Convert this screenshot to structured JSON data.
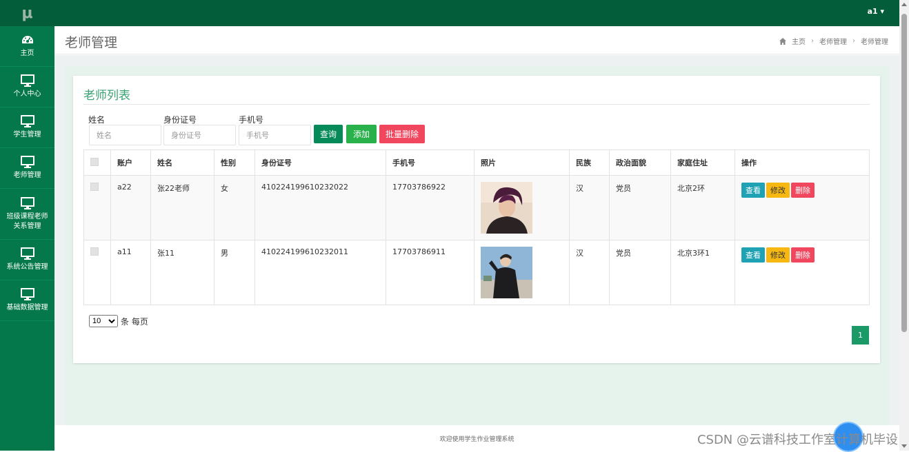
{
  "app": {
    "logo": "μ",
    "user": "a1 ▾"
  },
  "sidebar": {
    "items": [
      {
        "label": "主页",
        "icon": "dashboard-icon"
      },
      {
        "label": "个人中心",
        "icon": "monitor-icon"
      },
      {
        "label": "学生管理",
        "icon": "monitor-icon"
      },
      {
        "label": "老师管理",
        "icon": "monitor-icon"
      },
      {
        "label": "班级课程老师关系管理",
        "icon": "monitor-icon"
      },
      {
        "label": "系统公告管理",
        "icon": "monitor-icon"
      },
      {
        "label": "基础数据管理",
        "icon": "monitor-icon"
      }
    ]
  },
  "header": {
    "title": "老师管理",
    "breadcrumb": [
      "主页",
      "老师管理",
      "老师管理"
    ]
  },
  "card": {
    "title": "老师列表"
  },
  "filters": {
    "name_label": "姓名",
    "name_placeholder": "姓名",
    "id_label": "身份证号",
    "id_placeholder": "身份证号",
    "phone_label": "手机号",
    "phone_placeholder": "手机号"
  },
  "buttons": {
    "search": "查询",
    "add": "添加",
    "batch_delete": "批量删除"
  },
  "table": {
    "headers": [
      "账户",
      "姓名",
      "性别",
      "身份证号",
      "手机号",
      "照片",
      "民族",
      "政治面貌",
      "家庭住址",
      "操作"
    ],
    "rows": [
      {
        "account": "a22",
        "name": "张22老师",
        "gender": "女",
        "id": "410224199610232022",
        "phone": "17703786922",
        "ethnic": "汉",
        "political": "党员",
        "address": "北京2环"
      },
      {
        "account": "a11",
        "name": "张11",
        "gender": "男",
        "id": "410224199610232011",
        "phone": "17703786911",
        "ethnic": "汉",
        "political": "党员",
        "address": "北京3环1"
      }
    ],
    "ops": {
      "view": "查看",
      "edit": "修改",
      "delete": "删除"
    }
  },
  "pagination": {
    "page_size": "10",
    "page_size_suffix": "条 每页",
    "current_page": "1"
  },
  "footer": {
    "text": "欢迎使用学生作业管理系统"
  },
  "watermark": "CSDN @云谱科技工作室计算机毕设",
  "colors": {
    "sidebar": "#04784a",
    "topbar": "#035d3b",
    "accent": "#3aa172"
  }
}
